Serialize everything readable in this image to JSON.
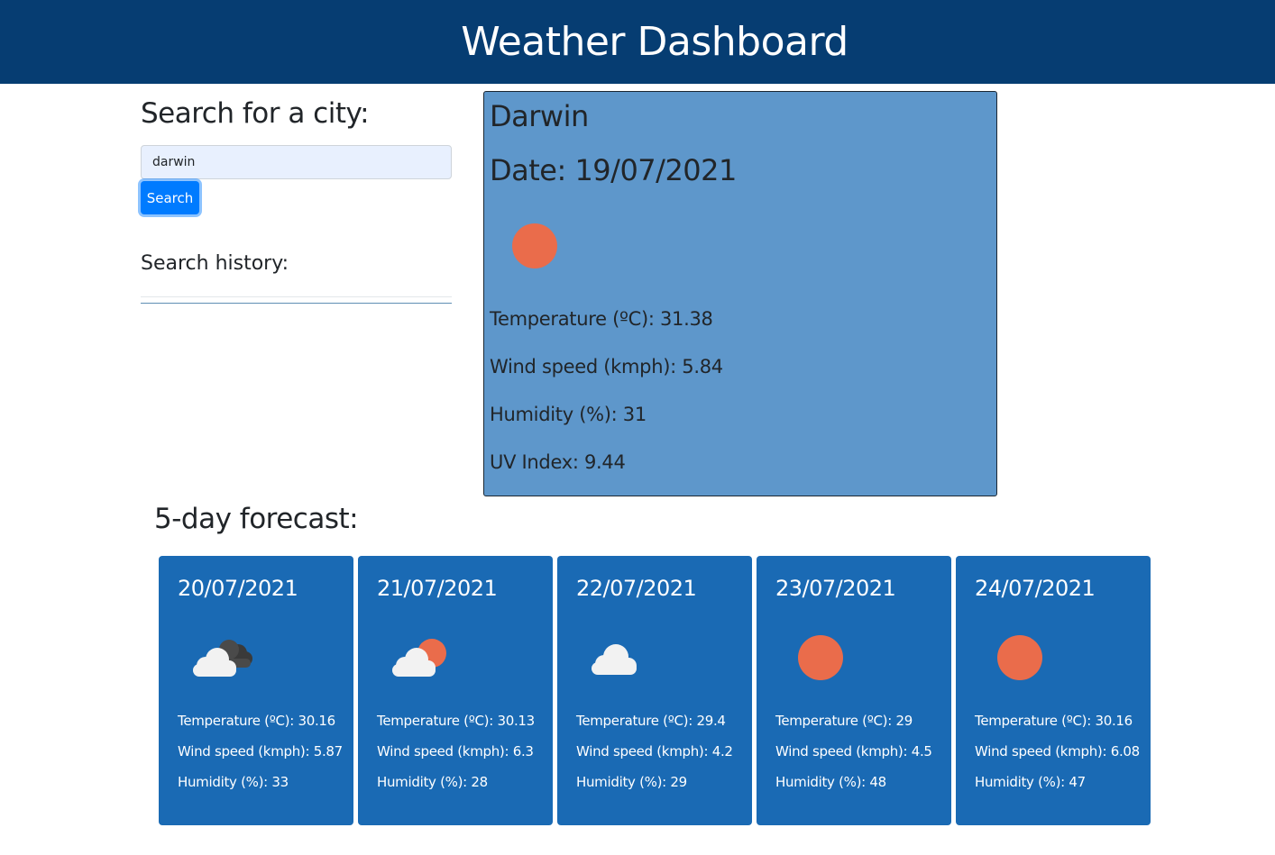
{
  "header": {
    "title": "Weather Dashboard"
  },
  "search": {
    "title": "Search for a city:",
    "input_value": "darwin",
    "button_label": "Search",
    "history_title": "Search history:"
  },
  "current": {
    "city": "Darwin",
    "date": "Date: 19/07/2021",
    "icon": "sun-icon",
    "temperature": "Temperature (ºC): 31.38",
    "wind": "Wind speed (kmph): 5.84",
    "humidity": "Humidity (%): 31",
    "uv": "UV Index: 9.44"
  },
  "forecast": {
    "title": "5-day forecast:",
    "days": [
      {
        "date": "20/07/2021",
        "icon": "broken-clouds-icon",
        "temperature": "Temperature (ºC): 30.16",
        "wind": "Wind speed (kmph): 5.87",
        "humidity": "Humidity (%): 33"
      },
      {
        "date": "21/07/2021",
        "icon": "few-clouds-icon",
        "temperature": "Temperature (ºC): 30.13",
        "wind": "Wind speed (kmph): 6.3",
        "humidity": "Humidity (%): 28"
      },
      {
        "date": "22/07/2021",
        "icon": "cloud-icon",
        "temperature": "Temperature (ºC): 29.4",
        "wind": "Wind speed (kmph): 4.2",
        "humidity": "Humidity (%): 29"
      },
      {
        "date": "23/07/2021",
        "icon": "sun-icon",
        "temperature": "Temperature (ºC): 29",
        "wind": "Wind speed (kmph): 4.5",
        "humidity": "Humidity (%): 48"
      },
      {
        "date": "24/07/2021",
        "icon": "sun-icon",
        "temperature": "Temperature (ºC): 30.16",
        "wind": "Wind speed (kmph): 6.08",
        "humidity": "Humidity (%): 47"
      }
    ]
  },
  "colors": {
    "header_bg": "#063d72",
    "current_card_bg": "#5e97cb",
    "forecast_card_bg": "#1a6ab4",
    "sun": "#ea6c4b",
    "button": "#007bff"
  }
}
